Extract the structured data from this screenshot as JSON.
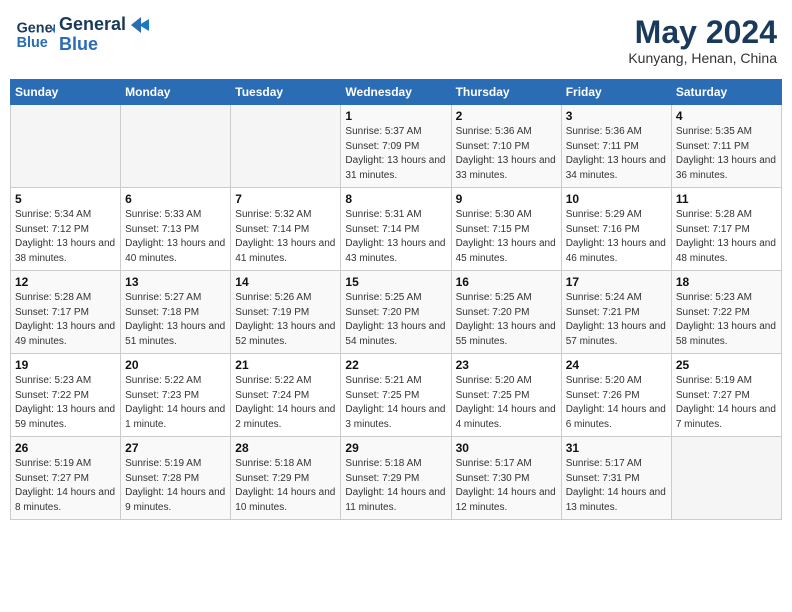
{
  "header": {
    "logo_general": "General",
    "logo_blue": "Blue",
    "title": "May 2024",
    "subtitle": "Kunyang, Henan, China"
  },
  "days_of_week": [
    "Sunday",
    "Monday",
    "Tuesday",
    "Wednesday",
    "Thursday",
    "Friday",
    "Saturday"
  ],
  "weeks": [
    {
      "cells": [
        {
          "day": null,
          "empty": true
        },
        {
          "day": null,
          "empty": true
        },
        {
          "day": null,
          "empty": true
        },
        {
          "day": "1",
          "sunrise": "Sunrise: 5:37 AM",
          "sunset": "Sunset: 7:09 PM",
          "daylight": "Daylight: 13 hours and 31 minutes."
        },
        {
          "day": "2",
          "sunrise": "Sunrise: 5:36 AM",
          "sunset": "Sunset: 7:10 PM",
          "daylight": "Daylight: 13 hours and 33 minutes."
        },
        {
          "day": "3",
          "sunrise": "Sunrise: 5:36 AM",
          "sunset": "Sunset: 7:11 PM",
          "daylight": "Daylight: 13 hours and 34 minutes."
        },
        {
          "day": "4",
          "sunrise": "Sunrise: 5:35 AM",
          "sunset": "Sunset: 7:11 PM",
          "daylight": "Daylight: 13 hours and 36 minutes."
        }
      ]
    },
    {
      "cells": [
        {
          "day": "5",
          "sunrise": "Sunrise: 5:34 AM",
          "sunset": "Sunset: 7:12 PM",
          "daylight": "Daylight: 13 hours and 38 minutes."
        },
        {
          "day": "6",
          "sunrise": "Sunrise: 5:33 AM",
          "sunset": "Sunset: 7:13 PM",
          "daylight": "Daylight: 13 hours and 40 minutes."
        },
        {
          "day": "7",
          "sunrise": "Sunrise: 5:32 AM",
          "sunset": "Sunset: 7:14 PM",
          "daylight": "Daylight: 13 hours and 41 minutes."
        },
        {
          "day": "8",
          "sunrise": "Sunrise: 5:31 AM",
          "sunset": "Sunset: 7:14 PM",
          "daylight": "Daylight: 13 hours and 43 minutes."
        },
        {
          "day": "9",
          "sunrise": "Sunrise: 5:30 AM",
          "sunset": "Sunset: 7:15 PM",
          "daylight": "Daylight: 13 hours and 45 minutes."
        },
        {
          "day": "10",
          "sunrise": "Sunrise: 5:29 AM",
          "sunset": "Sunset: 7:16 PM",
          "daylight": "Daylight: 13 hours and 46 minutes."
        },
        {
          "day": "11",
          "sunrise": "Sunrise: 5:28 AM",
          "sunset": "Sunset: 7:17 PM",
          "daylight": "Daylight: 13 hours and 48 minutes."
        }
      ]
    },
    {
      "cells": [
        {
          "day": "12",
          "sunrise": "Sunrise: 5:28 AM",
          "sunset": "Sunset: 7:17 PM",
          "daylight": "Daylight: 13 hours and 49 minutes."
        },
        {
          "day": "13",
          "sunrise": "Sunrise: 5:27 AM",
          "sunset": "Sunset: 7:18 PM",
          "daylight": "Daylight: 13 hours and 51 minutes."
        },
        {
          "day": "14",
          "sunrise": "Sunrise: 5:26 AM",
          "sunset": "Sunset: 7:19 PM",
          "daylight": "Daylight: 13 hours and 52 minutes."
        },
        {
          "day": "15",
          "sunrise": "Sunrise: 5:25 AM",
          "sunset": "Sunset: 7:20 PM",
          "daylight": "Daylight: 13 hours and 54 minutes."
        },
        {
          "day": "16",
          "sunrise": "Sunrise: 5:25 AM",
          "sunset": "Sunset: 7:20 PM",
          "daylight": "Daylight: 13 hours and 55 minutes."
        },
        {
          "day": "17",
          "sunrise": "Sunrise: 5:24 AM",
          "sunset": "Sunset: 7:21 PM",
          "daylight": "Daylight: 13 hours and 57 minutes."
        },
        {
          "day": "18",
          "sunrise": "Sunrise: 5:23 AM",
          "sunset": "Sunset: 7:22 PM",
          "daylight": "Daylight: 13 hours and 58 minutes."
        }
      ]
    },
    {
      "cells": [
        {
          "day": "19",
          "sunrise": "Sunrise: 5:23 AM",
          "sunset": "Sunset: 7:22 PM",
          "daylight": "Daylight: 13 hours and 59 minutes."
        },
        {
          "day": "20",
          "sunrise": "Sunrise: 5:22 AM",
          "sunset": "Sunset: 7:23 PM",
          "daylight": "Daylight: 14 hours and 1 minute."
        },
        {
          "day": "21",
          "sunrise": "Sunrise: 5:22 AM",
          "sunset": "Sunset: 7:24 PM",
          "daylight": "Daylight: 14 hours and 2 minutes."
        },
        {
          "day": "22",
          "sunrise": "Sunrise: 5:21 AM",
          "sunset": "Sunset: 7:25 PM",
          "daylight": "Daylight: 14 hours and 3 minutes."
        },
        {
          "day": "23",
          "sunrise": "Sunrise: 5:20 AM",
          "sunset": "Sunset: 7:25 PM",
          "daylight": "Daylight: 14 hours and 4 minutes."
        },
        {
          "day": "24",
          "sunrise": "Sunrise: 5:20 AM",
          "sunset": "Sunset: 7:26 PM",
          "daylight": "Daylight: 14 hours and 6 minutes."
        },
        {
          "day": "25",
          "sunrise": "Sunrise: 5:19 AM",
          "sunset": "Sunset: 7:27 PM",
          "daylight": "Daylight: 14 hours and 7 minutes."
        }
      ]
    },
    {
      "cells": [
        {
          "day": "26",
          "sunrise": "Sunrise: 5:19 AM",
          "sunset": "Sunset: 7:27 PM",
          "daylight": "Daylight: 14 hours and 8 minutes."
        },
        {
          "day": "27",
          "sunrise": "Sunrise: 5:19 AM",
          "sunset": "Sunset: 7:28 PM",
          "daylight": "Daylight: 14 hours and 9 minutes."
        },
        {
          "day": "28",
          "sunrise": "Sunrise: 5:18 AM",
          "sunset": "Sunset: 7:29 PM",
          "daylight": "Daylight: 14 hours and 10 minutes."
        },
        {
          "day": "29",
          "sunrise": "Sunrise: 5:18 AM",
          "sunset": "Sunset: 7:29 PM",
          "daylight": "Daylight: 14 hours and 11 minutes."
        },
        {
          "day": "30",
          "sunrise": "Sunrise: 5:17 AM",
          "sunset": "Sunset: 7:30 PM",
          "daylight": "Daylight: 14 hours and 12 minutes."
        },
        {
          "day": "31",
          "sunrise": "Sunrise: 5:17 AM",
          "sunset": "Sunset: 7:31 PM",
          "daylight": "Daylight: 14 hours and 13 minutes."
        },
        {
          "day": null,
          "empty": true
        }
      ]
    }
  ]
}
